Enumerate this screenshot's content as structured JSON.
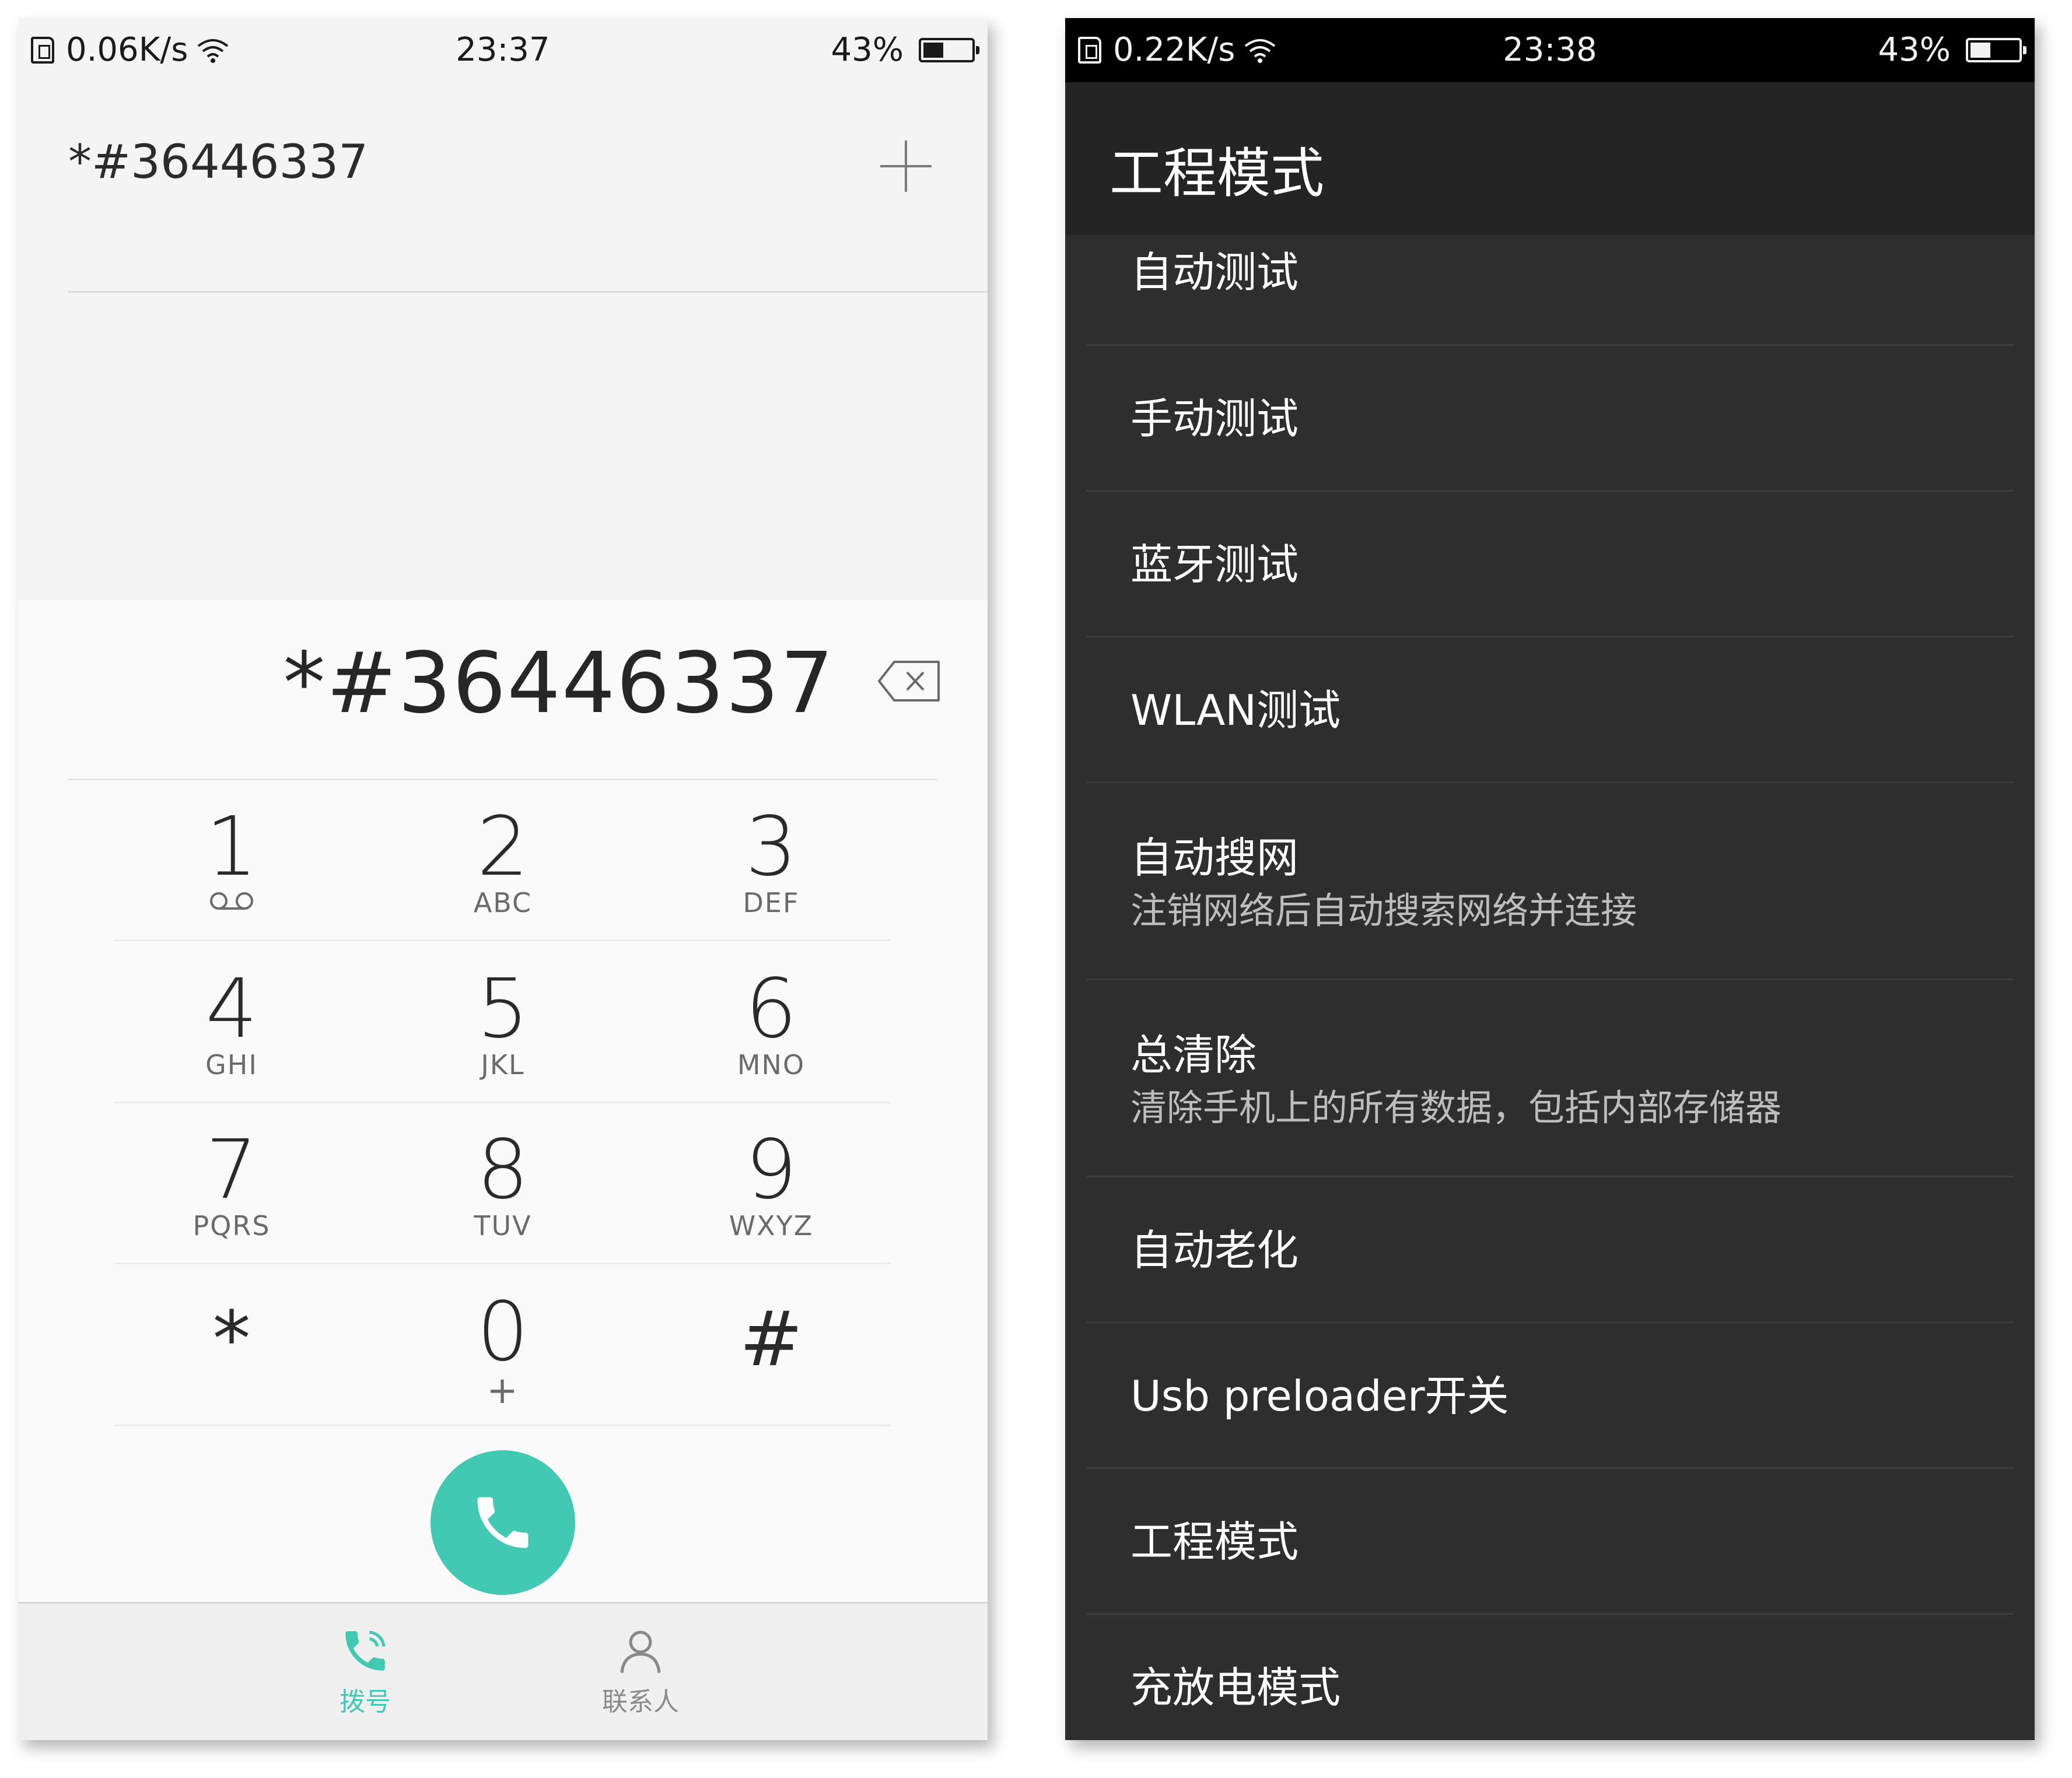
{
  "left": {
    "status": {
      "speed": "0.06K/s",
      "time": "23:37",
      "battery": "43%",
      "battery_level": 0.43
    },
    "match_number": "*#36446337",
    "entered_number": "*#36446337",
    "keys": [
      {
        "digit": "1",
        "letters": ""
      },
      {
        "digit": "2",
        "letters": "ABC"
      },
      {
        "digit": "3",
        "letters": "DEF"
      },
      {
        "digit": "4",
        "letters": "GHI"
      },
      {
        "digit": "5",
        "letters": "JKL"
      },
      {
        "digit": "6",
        "letters": "MNO"
      },
      {
        "digit": "7",
        "letters": "PQRS"
      },
      {
        "digit": "8",
        "letters": "TUV"
      },
      {
        "digit": "9",
        "letters": "WXYZ"
      },
      {
        "digit": "*",
        "letters": ""
      },
      {
        "digit": "0",
        "letters": "+"
      },
      {
        "digit": "#",
        "letters": ""
      }
    ],
    "tabs": {
      "dial": "拨号",
      "contacts": "联系人"
    },
    "colors": {
      "accent": "#41c9b4"
    }
  },
  "right": {
    "status": {
      "speed": "0.22K/s",
      "time": "23:38",
      "battery": "43%",
      "battery_level": 0.43
    },
    "title": "工程模式",
    "items": [
      {
        "title": "自动测试"
      },
      {
        "title": "手动测试"
      },
      {
        "title": "蓝牙测试"
      },
      {
        "title": "WLAN测试"
      },
      {
        "title": "自动搜网",
        "subtitle": "注销网络后自动搜索网络并连接"
      },
      {
        "title": "总清除",
        "subtitle": "清除手机上的所有数据，包括内部存储器"
      },
      {
        "title": "自动老化"
      },
      {
        "title": "Usb preloader开关"
      },
      {
        "title": "工程模式"
      },
      {
        "title": "充放电模式"
      }
    ]
  }
}
